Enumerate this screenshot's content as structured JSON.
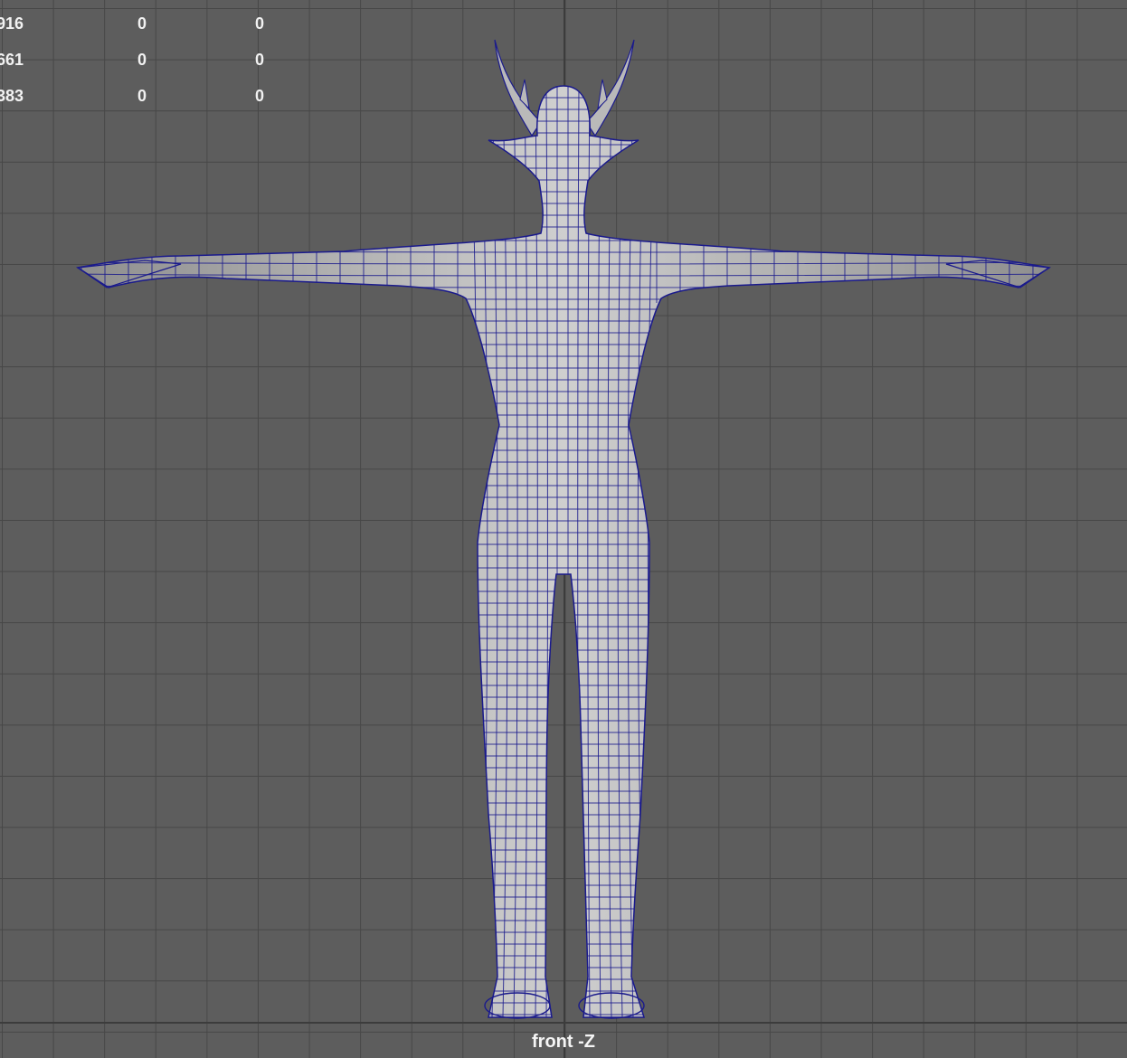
{
  "viewport": {
    "camera_label": "front -Z",
    "wireframe_color": "#1a1a8c",
    "shaded_color": "#c8c8c8",
    "grid_color": "#474747",
    "background_color": "#5d5d5d"
  },
  "hud": {
    "rows": [
      [
        "916",
        "0",
        "0"
      ],
      [
        "661",
        "0",
        "0"
      ],
      [
        "383",
        "0",
        "0"
      ]
    ]
  },
  "model": {
    "icon": "character-mesh-icon"
  }
}
